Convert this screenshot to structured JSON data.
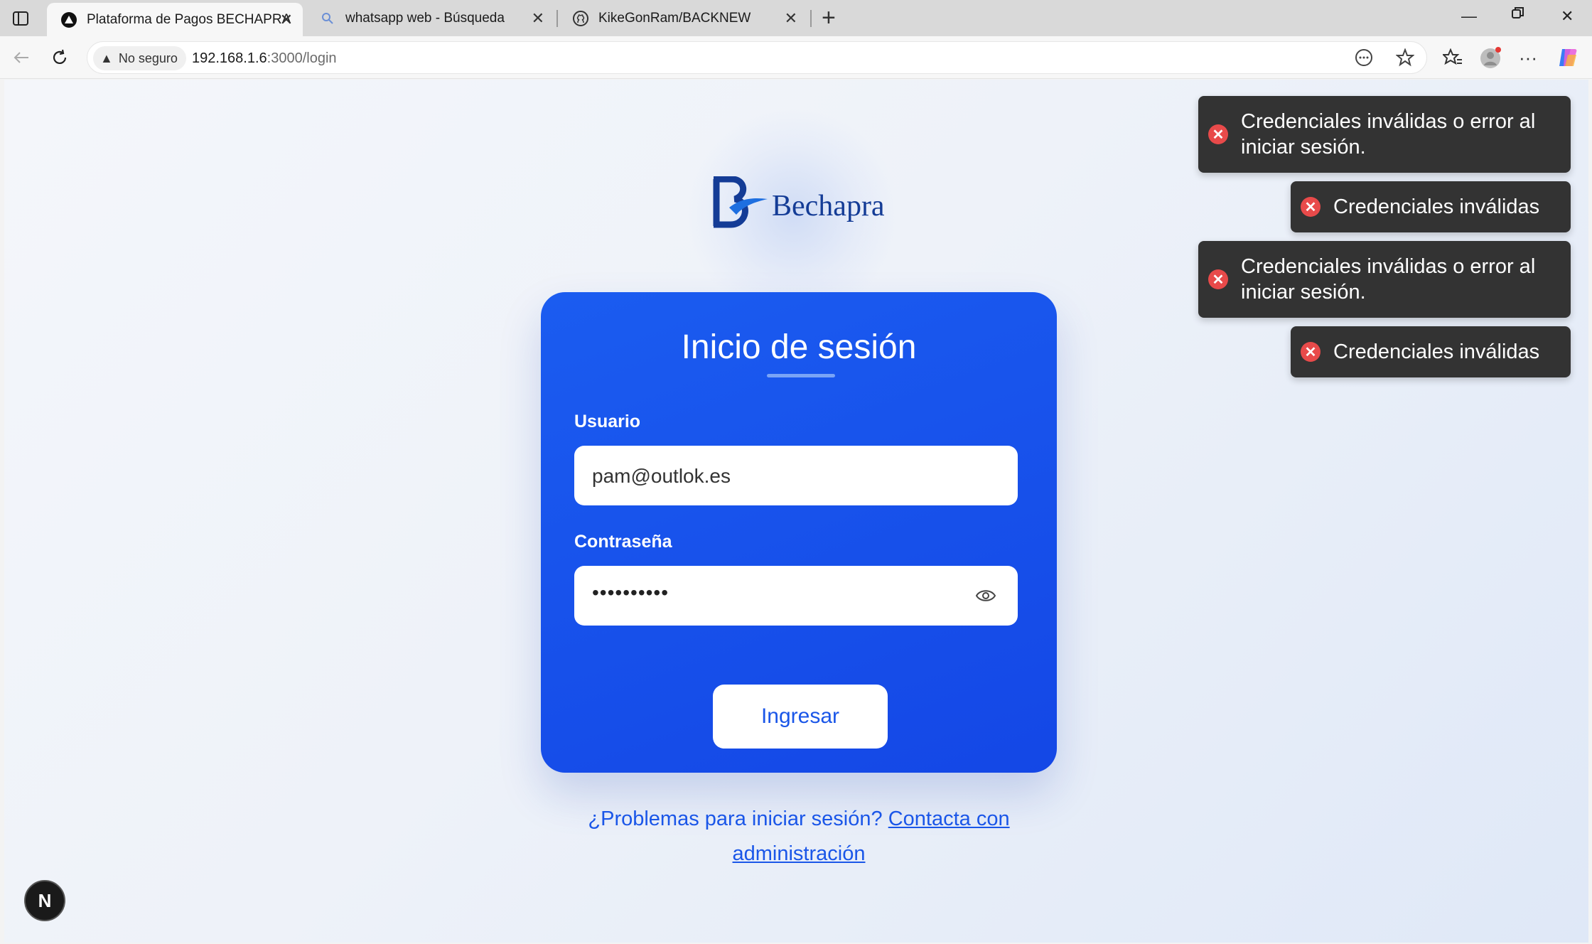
{
  "browser": {
    "tabs": [
      {
        "label": "Plataforma de Pagos BECHAPRA",
        "active": true
      },
      {
        "label": "whatsapp web - Búsqueda",
        "active": false
      },
      {
        "label": "KikeGonRam/BACKNEW",
        "active": false
      }
    ],
    "security_label": "No seguro",
    "url_host": "192.168.1.6",
    "url_path": ":3000/login"
  },
  "page": {
    "logo_text": "Bechapra",
    "login": {
      "title": "Inicio de sesión",
      "username_label": "Usuario",
      "username_value": "pam@outlok.es",
      "password_label": "Contraseña",
      "password_mask": "••••••••••",
      "submit_label": "Ingresar"
    },
    "help": {
      "question": "¿Problemas para iniciar sesión?",
      "link_part1": "Contacta con",
      "link_part2": "administración"
    },
    "dev_badge": "N"
  },
  "toasts": [
    {
      "line1": "Credenciales inválidas o error al",
      "line2": "iniciar sesión."
    },
    {
      "line1": "Credenciales inválidas"
    },
    {
      "line1": "Credenciales inválidas o error al",
      "line2": "iniciar sesión."
    },
    {
      "line1": "Credenciales inválidas"
    }
  ],
  "colors": {
    "card": "#1b5cf0",
    "accent": "#1a56e8",
    "toast_bg": "#333333",
    "error_icon": "#e84a4a"
  }
}
